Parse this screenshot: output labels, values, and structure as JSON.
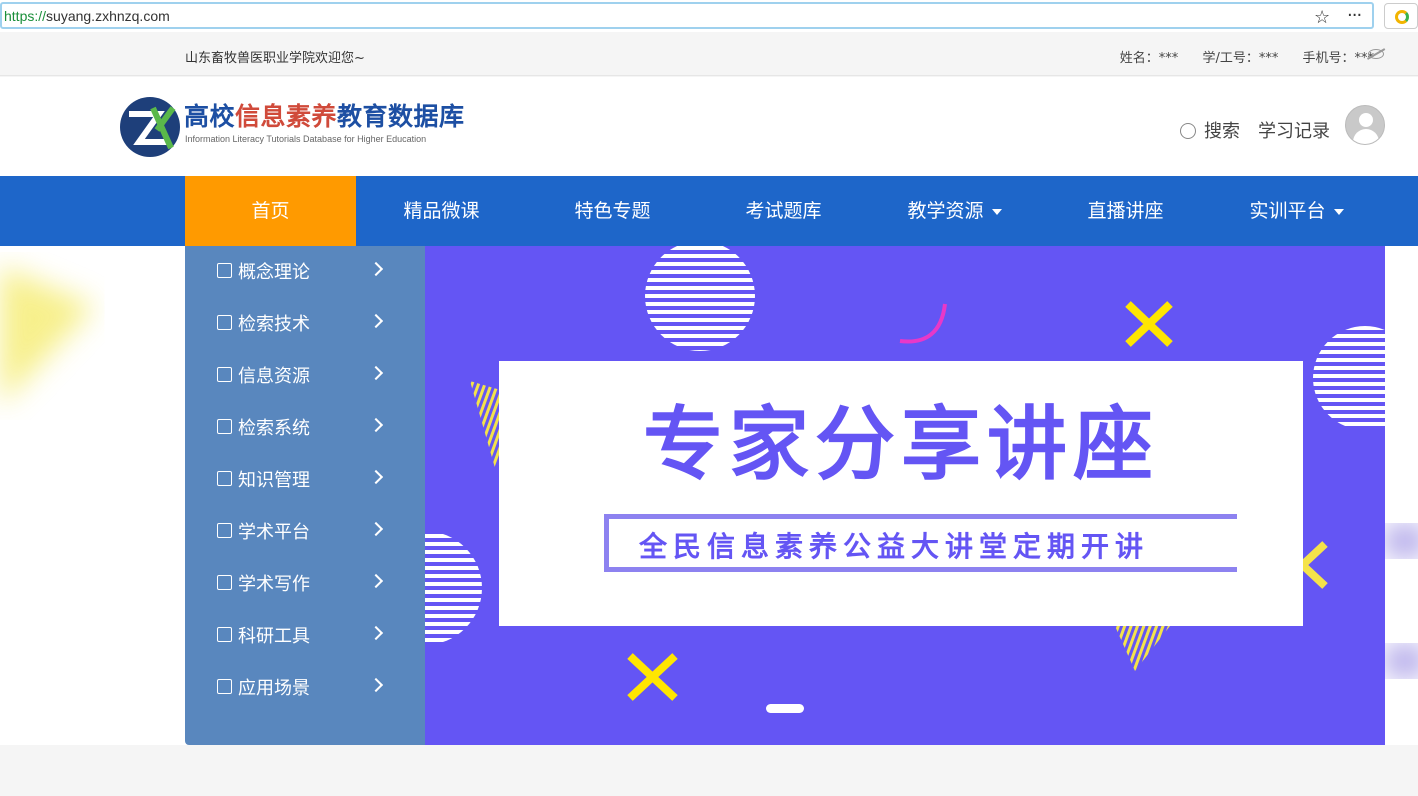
{
  "browser": {
    "url_scheme": "https://",
    "url_host": "suyang.zxhnzq.com",
    "star_icon": "star-icon",
    "more_icon": "more-icon"
  },
  "topbar": {
    "welcome": "山东畜牧兽医职业学院欢迎您~",
    "name_label": "姓名：***",
    "id_label": "学/工号：***",
    "phone_label": "手机号：***"
  },
  "header": {
    "logo_title_a": "高校",
    "logo_title_b": "信息素养",
    "logo_title_c": "教育数据库",
    "logo_sub": "Information Literacy Tutorials Database for Higher Education",
    "search": "搜索",
    "history": "学习记录"
  },
  "nav": {
    "items": [
      {
        "label": "首页",
        "active": true
      },
      {
        "label": "精品微课"
      },
      {
        "label": "特色专题"
      },
      {
        "label": "考试题库"
      },
      {
        "label": "教学资源",
        "dropdown": true
      },
      {
        "label": "直播讲座"
      },
      {
        "label": "实训平台",
        "dropdown": true
      }
    ]
  },
  "sidemenu": {
    "items": [
      {
        "label": "概念理论",
        "icon": "document-icon"
      },
      {
        "label": "检索技术",
        "icon": "search-doc-icon"
      },
      {
        "label": "信息资源",
        "icon": "files-icon"
      },
      {
        "label": "检索系统",
        "icon": "chart-icon"
      },
      {
        "label": "知识管理",
        "icon": "tools-icon"
      },
      {
        "label": "学术平台",
        "icon": "certificate-icon"
      },
      {
        "label": "学术写作",
        "icon": "edit-doc-icon"
      },
      {
        "label": "科研工具",
        "icon": "layers-icon"
      },
      {
        "label": "应用场景",
        "icon": "grid-icon"
      }
    ]
  },
  "banner": {
    "title": "专家分享讲座",
    "subtitle": "全民信息素养公益大讲堂定期开讲",
    "bg_color": "#6455f4"
  },
  "colors": {
    "nav_bg": "#1e66c9",
    "nav_active": "#ff9a00",
    "sidemenu_bg": "#4b7db9"
  }
}
